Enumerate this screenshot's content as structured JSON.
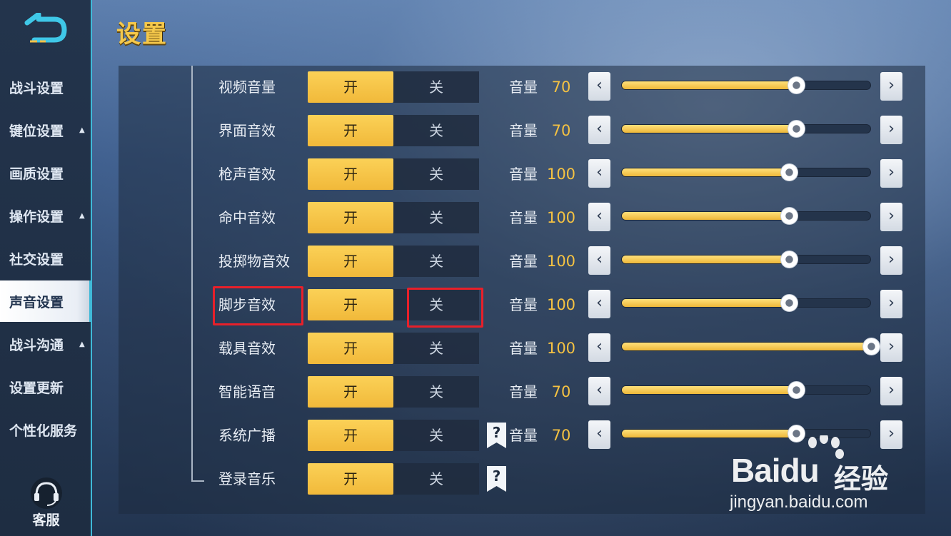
{
  "page": {
    "title": "设置"
  },
  "sidebar": {
    "items": [
      {
        "label": "战斗设置",
        "caret": ""
      },
      {
        "label": "键位设置",
        "caret": "▲"
      },
      {
        "label": "画质设置",
        "caret": ""
      },
      {
        "label": "操作设置",
        "caret": "▲"
      },
      {
        "label": "社交设置",
        "caret": ""
      },
      {
        "label": "声音设置",
        "caret": "",
        "active": true
      },
      {
        "label": "战斗沟通",
        "caret": "▲"
      },
      {
        "label": "设置更新",
        "caret": ""
      },
      {
        "label": "个性化服务",
        "caret": ""
      }
    ],
    "support_label": "客服"
  },
  "sound": {
    "on_label": "开",
    "off_label": "关",
    "volume_label": "音量",
    "rows": [
      {
        "label": "视频音量",
        "state": "on",
        "volume": 70,
        "has_volume": true,
        "help": false
      },
      {
        "label": "界面音效",
        "state": "on",
        "volume": 70,
        "has_volume": true,
        "help": false
      },
      {
        "label": "枪声音效",
        "state": "on",
        "volume": 100,
        "has_volume": true,
        "help": false
      },
      {
        "label": "命中音效",
        "state": "on",
        "volume": 100,
        "has_volume": true,
        "help": false
      },
      {
        "label": "投掷物音效",
        "state": "on",
        "volume": 100,
        "has_volume": true,
        "help": false
      },
      {
        "label": "脚步音效",
        "state": "on",
        "volume": 100,
        "has_volume": true,
        "help": false,
        "highlighted": true
      },
      {
        "label": "载具音效",
        "state": "on",
        "volume": 100,
        "has_volume": true,
        "help": false
      },
      {
        "label": "智能语音",
        "state": "on",
        "volume": 70,
        "has_volume": true,
        "help": false
      },
      {
        "label": "系统广播",
        "state": "on",
        "volume": 70,
        "has_volume": true,
        "help": true
      },
      {
        "label": "登录音乐",
        "state": "on",
        "has_volume": false,
        "help": true
      }
    ],
    "slider_levels": [
      0.7,
      0.7,
      0.67,
      0.67,
      0.67,
      0.67,
      1.0,
      0.7,
      0.7
    ]
  },
  "watermark": {
    "brand": "Baidu",
    "cn": "经验",
    "url": "jingyan.baidu.com"
  },
  "colors": {
    "accent": "#f5c242",
    "toggle_on": "#f1b93a",
    "sidebar_edge": "#3fb9d8",
    "highlight": "#e8202a"
  }
}
